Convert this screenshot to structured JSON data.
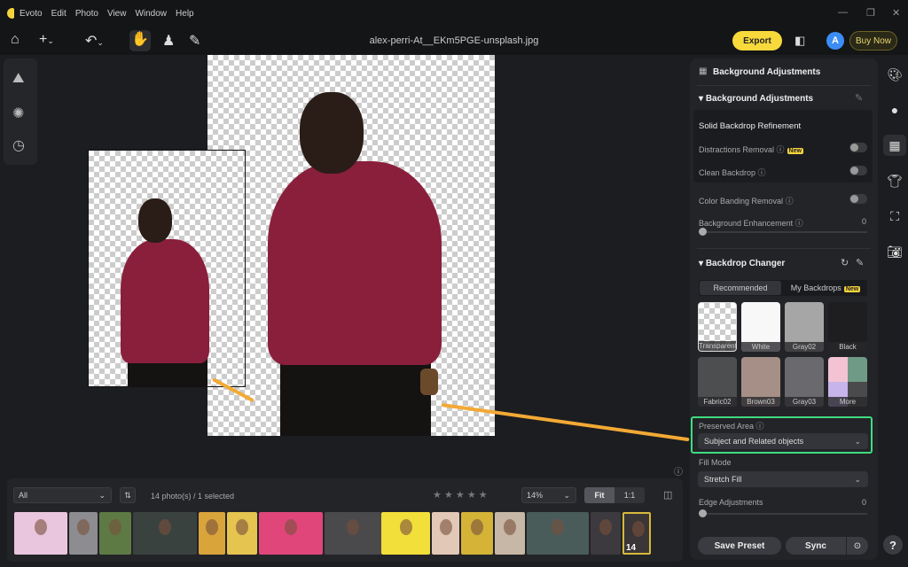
{
  "app": {
    "name": "Evoto",
    "menu": [
      "Evoto",
      "Edit",
      "Photo",
      "View",
      "Window",
      "Help"
    ],
    "window_controls": [
      "—",
      "❐",
      "✕"
    ]
  },
  "toolbar": {
    "file_title": "alex-perri-At__EKm5PGE-unsplash.jpg",
    "export_label": "Export",
    "avatar_letter": "A",
    "buy_label": "Buy Now"
  },
  "panel": {
    "header": "Background Adjustments",
    "section1": {
      "title": "Background Adjustments",
      "sub_title": "Solid Backdrop Refinement",
      "distractions": "Distractions Removal",
      "new_badge": "New",
      "clean": "Clean Backdrop",
      "banding": "Color Banding Removal",
      "enhancement": "Background Enhancement",
      "enhancement_value": "0"
    },
    "section2": {
      "title": "Backdrop Changer",
      "tab_recommended": "Recommended",
      "tab_my": "My Backdrops",
      "new_badge": "New",
      "backdrops": [
        {
          "name": "Transparent"
        },
        {
          "name": "White",
          "color": "#f8f8f8"
        },
        {
          "name": "Gray02",
          "color": "#a6a6a6"
        },
        {
          "name": "Black",
          "color": "#1e1e20"
        },
        {
          "name": "Fabric02",
          "color": "#4c4e4f"
        },
        {
          "name": "Brown03",
          "color": "#a58f86"
        },
        {
          "name": "Gray03",
          "color": "#6a6a6e"
        },
        {
          "name": "More"
        }
      ],
      "preserved_label": "Preserved Area",
      "preserved_value": "Subject and Related objects",
      "fill_label": "Fill Mode",
      "fill_value": "Stretch Fill",
      "edge_label": "Edge Adjustments",
      "edge_value": "0"
    },
    "save_preset": "Save Preset",
    "sync": "Sync",
    "help": "?"
  },
  "bottom": {
    "filter": "All",
    "count": "14 photo(s) / 1 selected",
    "zoom": "14%",
    "fit": "Fit",
    "one_to_one": "1:1",
    "rating": 0,
    "selected_index": "14",
    "thumbnails": [
      "#e9c6dd",
      "#8d8c90",
      "#5d7a45",
      "#3a4240",
      "#d9a43a",
      "#e5c44f",
      "#e0467a",
      "#4a4a4c",
      "#f2df3a",
      "#e2c8b7",
      "#d4b337",
      "#c7b7a6",
      "#4a5c5a",
      "#3c3a3e",
      "#3a3536"
    ]
  },
  "colors": {
    "accent": "#f7d93b",
    "highlight": "#3fdc7f",
    "arrow": "#f3a935"
  }
}
